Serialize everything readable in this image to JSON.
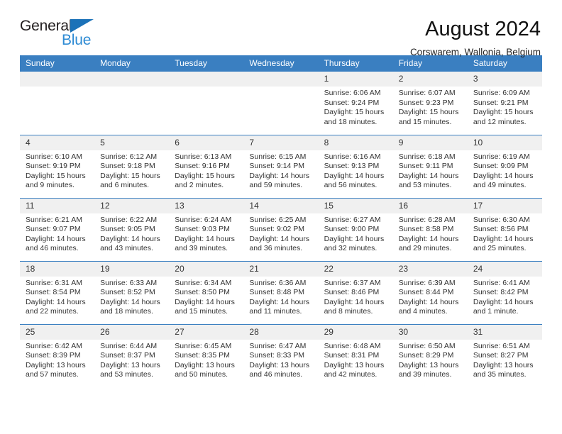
{
  "brand": {
    "name_part1": "General",
    "name_part2": "Blue",
    "logo_icon": "blue-triangle-icon"
  },
  "header": {
    "title": "August 2024",
    "subtitle": "Corswarem, Wallonia, Belgium"
  },
  "calendar": {
    "weekday_headers": [
      "Sunday",
      "Monday",
      "Tuesday",
      "Wednesday",
      "Thursday",
      "Friday",
      "Saturday"
    ],
    "accent_color": "#3a7fc1",
    "daynum_band_color": "#f0f0f0",
    "weeks": [
      [
        {
          "day": "",
          "empty": true
        },
        {
          "day": "",
          "empty": true
        },
        {
          "day": "",
          "empty": true
        },
        {
          "day": "",
          "empty": true
        },
        {
          "day": "1",
          "sunrise": "Sunrise: 6:06 AM",
          "sunset": "Sunset: 9:24 PM",
          "daylight": "Daylight: 15 hours and 18 minutes."
        },
        {
          "day": "2",
          "sunrise": "Sunrise: 6:07 AM",
          "sunset": "Sunset: 9:23 PM",
          "daylight": "Daylight: 15 hours and 15 minutes."
        },
        {
          "day": "3",
          "sunrise": "Sunrise: 6:09 AM",
          "sunset": "Sunset: 9:21 PM",
          "daylight": "Daylight: 15 hours and 12 minutes."
        }
      ],
      [
        {
          "day": "4",
          "sunrise": "Sunrise: 6:10 AM",
          "sunset": "Sunset: 9:19 PM",
          "daylight": "Daylight: 15 hours and 9 minutes."
        },
        {
          "day": "5",
          "sunrise": "Sunrise: 6:12 AM",
          "sunset": "Sunset: 9:18 PM",
          "daylight": "Daylight: 15 hours and 6 minutes."
        },
        {
          "day": "6",
          "sunrise": "Sunrise: 6:13 AM",
          "sunset": "Sunset: 9:16 PM",
          "daylight": "Daylight: 15 hours and 2 minutes."
        },
        {
          "day": "7",
          "sunrise": "Sunrise: 6:15 AM",
          "sunset": "Sunset: 9:14 PM",
          "daylight": "Daylight: 14 hours and 59 minutes."
        },
        {
          "day": "8",
          "sunrise": "Sunrise: 6:16 AM",
          "sunset": "Sunset: 9:13 PM",
          "daylight": "Daylight: 14 hours and 56 minutes."
        },
        {
          "day": "9",
          "sunrise": "Sunrise: 6:18 AM",
          "sunset": "Sunset: 9:11 PM",
          "daylight": "Daylight: 14 hours and 53 minutes."
        },
        {
          "day": "10",
          "sunrise": "Sunrise: 6:19 AM",
          "sunset": "Sunset: 9:09 PM",
          "daylight": "Daylight: 14 hours and 49 minutes."
        }
      ],
      [
        {
          "day": "11",
          "sunrise": "Sunrise: 6:21 AM",
          "sunset": "Sunset: 9:07 PM",
          "daylight": "Daylight: 14 hours and 46 minutes."
        },
        {
          "day": "12",
          "sunrise": "Sunrise: 6:22 AM",
          "sunset": "Sunset: 9:05 PM",
          "daylight": "Daylight: 14 hours and 43 minutes."
        },
        {
          "day": "13",
          "sunrise": "Sunrise: 6:24 AM",
          "sunset": "Sunset: 9:03 PM",
          "daylight": "Daylight: 14 hours and 39 minutes."
        },
        {
          "day": "14",
          "sunrise": "Sunrise: 6:25 AM",
          "sunset": "Sunset: 9:02 PM",
          "daylight": "Daylight: 14 hours and 36 minutes."
        },
        {
          "day": "15",
          "sunrise": "Sunrise: 6:27 AM",
          "sunset": "Sunset: 9:00 PM",
          "daylight": "Daylight: 14 hours and 32 minutes."
        },
        {
          "day": "16",
          "sunrise": "Sunrise: 6:28 AM",
          "sunset": "Sunset: 8:58 PM",
          "daylight": "Daylight: 14 hours and 29 minutes."
        },
        {
          "day": "17",
          "sunrise": "Sunrise: 6:30 AM",
          "sunset": "Sunset: 8:56 PM",
          "daylight": "Daylight: 14 hours and 25 minutes."
        }
      ],
      [
        {
          "day": "18",
          "sunrise": "Sunrise: 6:31 AM",
          "sunset": "Sunset: 8:54 PM",
          "daylight": "Daylight: 14 hours and 22 minutes."
        },
        {
          "day": "19",
          "sunrise": "Sunrise: 6:33 AM",
          "sunset": "Sunset: 8:52 PM",
          "daylight": "Daylight: 14 hours and 18 minutes."
        },
        {
          "day": "20",
          "sunrise": "Sunrise: 6:34 AM",
          "sunset": "Sunset: 8:50 PM",
          "daylight": "Daylight: 14 hours and 15 minutes."
        },
        {
          "day": "21",
          "sunrise": "Sunrise: 6:36 AM",
          "sunset": "Sunset: 8:48 PM",
          "daylight": "Daylight: 14 hours and 11 minutes."
        },
        {
          "day": "22",
          "sunrise": "Sunrise: 6:37 AM",
          "sunset": "Sunset: 8:46 PM",
          "daylight": "Daylight: 14 hours and 8 minutes."
        },
        {
          "day": "23",
          "sunrise": "Sunrise: 6:39 AM",
          "sunset": "Sunset: 8:44 PM",
          "daylight": "Daylight: 14 hours and 4 minutes."
        },
        {
          "day": "24",
          "sunrise": "Sunrise: 6:41 AM",
          "sunset": "Sunset: 8:42 PM",
          "daylight": "Daylight: 14 hours and 1 minute."
        }
      ],
      [
        {
          "day": "25",
          "sunrise": "Sunrise: 6:42 AM",
          "sunset": "Sunset: 8:39 PM",
          "daylight": "Daylight: 13 hours and 57 minutes."
        },
        {
          "day": "26",
          "sunrise": "Sunrise: 6:44 AM",
          "sunset": "Sunset: 8:37 PM",
          "daylight": "Daylight: 13 hours and 53 minutes."
        },
        {
          "day": "27",
          "sunrise": "Sunrise: 6:45 AM",
          "sunset": "Sunset: 8:35 PM",
          "daylight": "Daylight: 13 hours and 50 minutes."
        },
        {
          "day": "28",
          "sunrise": "Sunrise: 6:47 AM",
          "sunset": "Sunset: 8:33 PM",
          "daylight": "Daylight: 13 hours and 46 minutes."
        },
        {
          "day": "29",
          "sunrise": "Sunrise: 6:48 AM",
          "sunset": "Sunset: 8:31 PM",
          "daylight": "Daylight: 13 hours and 42 minutes."
        },
        {
          "day": "30",
          "sunrise": "Sunrise: 6:50 AM",
          "sunset": "Sunset: 8:29 PM",
          "daylight": "Daylight: 13 hours and 39 minutes."
        },
        {
          "day": "31",
          "sunrise": "Sunrise: 6:51 AM",
          "sunset": "Sunset: 8:27 PM",
          "daylight": "Daylight: 13 hours and 35 minutes."
        }
      ]
    ]
  }
}
